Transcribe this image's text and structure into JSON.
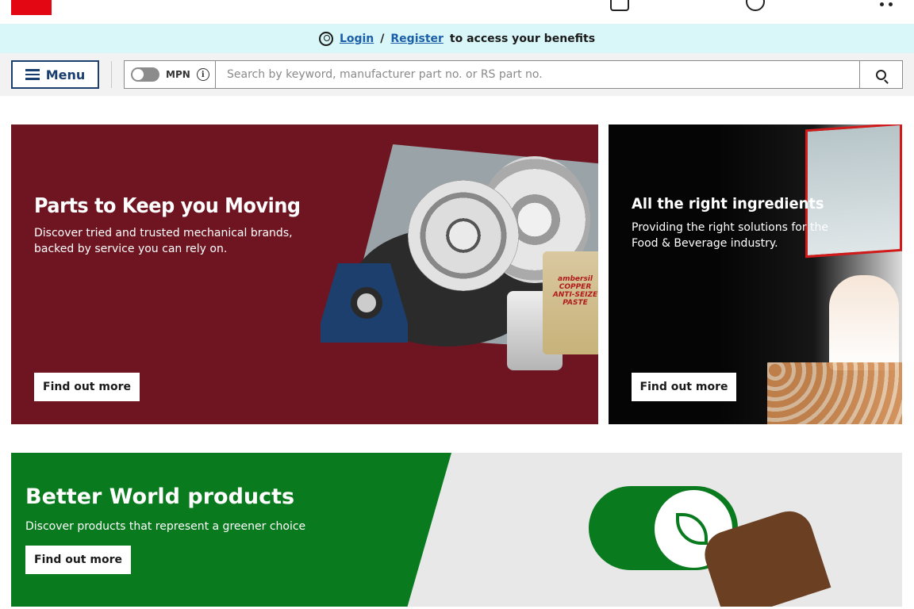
{
  "benefits": {
    "login": "Login",
    "separator": "/",
    "register": "Register",
    "suffix": "to access your benefits"
  },
  "nav": {
    "menu_label": "Menu",
    "mpn_label": "MPN",
    "search_placeholder": "Search by keyword, manufacturer part no. or RS part no."
  },
  "banners": [
    {
      "title": "Parts to Keep you Moving",
      "description": "Discover tried and trusted mechanical brands, backed by service you can rely on.",
      "button": "Find out more",
      "product_label": "ambersil COPPER ANTI-SEIZE PASTE"
    },
    {
      "title": "All the right ingredients",
      "description": "Providing the right solutions for the Food & Beverage industry.",
      "button": "Find out more"
    },
    {
      "title": "Better World products",
      "description": "Discover products that represent a greener choice",
      "button": "Find out more"
    }
  ],
  "colors": {
    "benefit_bar": "#d9f7f9",
    "link": "#1a5fa8",
    "menu_accent": "#1a3f6f",
    "banner1": "#6e1521",
    "banner3_green": "#0a7a1e"
  },
  "icons": [
    "user-circle-icon",
    "hamburger-icon",
    "toggle-icon",
    "info-icon",
    "search-icon",
    "cart-icon",
    "leaf-icon"
  ]
}
